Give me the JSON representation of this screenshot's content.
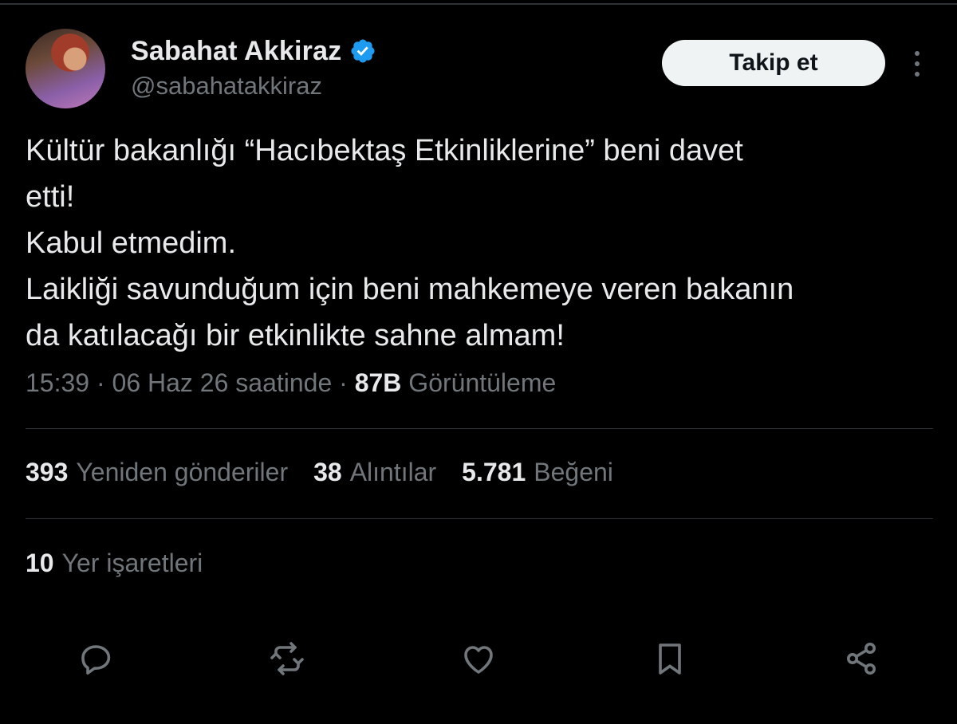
{
  "author": {
    "name": "Sabahat Akkiraz",
    "handle": "@sabahatakkiraz",
    "verified_icon": "verified-badge-icon",
    "avatar": "profile-photo"
  },
  "follow_button": {
    "label": "Takip et"
  },
  "more_icon": "more-vertical-icon",
  "tweet": {
    "lines": [
      "Kültür bakanlığı “Hacıbektaş Etkinliklerine” beni davet",
      "etti!",
      "Kabul etmedim.",
      "Laikliği savunduğum için beni mahkemeye veren bakanın",
      "da katılacağı bir etkinlikte sahne almam!"
    ]
  },
  "meta": {
    "time": "15:39",
    "date": "06 Haz 26 saatinde",
    "separator": "·",
    "views_count": "87B",
    "views_label": "Görüntüleme"
  },
  "stats": {
    "reposts_count": "393",
    "reposts_label": "Yeniden gönderiler",
    "quotes_count": "38",
    "quotes_label": "Alıntılar",
    "likes_count": "5.781",
    "likes_label": "Beğeni"
  },
  "bookmarks": {
    "count": "10",
    "label": "Yer işaretleri"
  },
  "actions": [
    "reply-icon",
    "repost-icon",
    "like-icon",
    "bookmark-icon",
    "share-icon"
  ],
  "colors": {
    "background": "#000000",
    "text": "#e7e9ea",
    "secondary": "#71767b",
    "divider": "#2f3336",
    "verified": "#1d9bf0",
    "button_bg": "#eff3f4"
  }
}
